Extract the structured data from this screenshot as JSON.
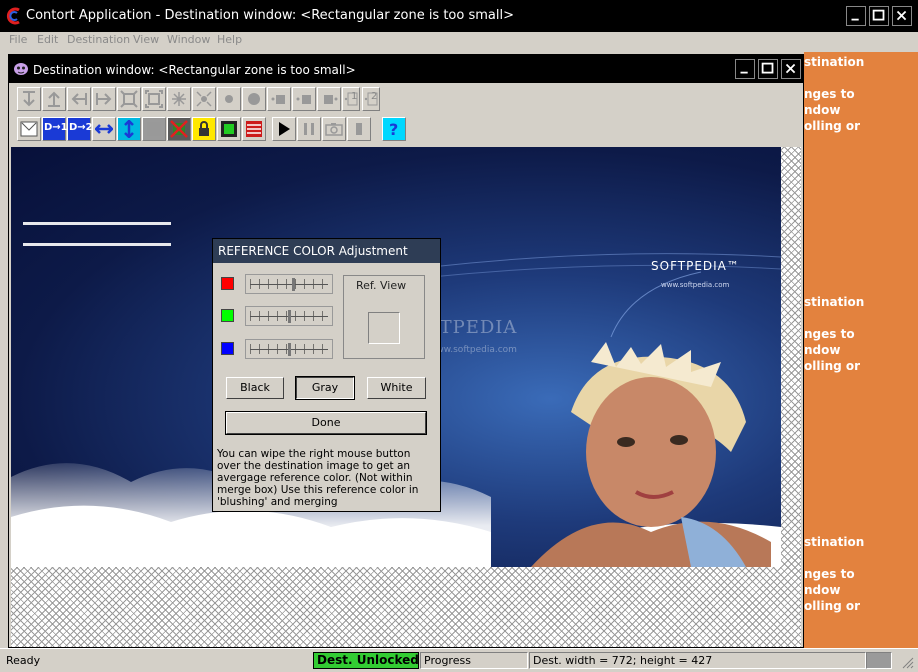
{
  "app": {
    "title": "Contort Application - Destination window: <Rectangular zone is too small>",
    "menu": [
      "File",
      "Edit",
      "Destination",
      "View",
      "Window",
      "Help"
    ]
  },
  "background_window_text": {
    "block1": [
      "stination",
      "",
      "nges to",
      "ndow",
      "olling or"
    ],
    "block2": [
      "stination",
      "",
      "nges to",
      "ndow",
      "olling or"
    ],
    "block3": [
      "stination",
      "",
      "nges to",
      "ndow",
      "olling or"
    ]
  },
  "child_window": {
    "title": "Destination window: <Rectangular zone is too small>",
    "toolbar_row1_icons": [
      "flip-down-icon",
      "flip-up-icon",
      "arrow-left-icon",
      "arrow-right-icon",
      "shrink-icon",
      "expand-icon",
      "zoom-in-icon",
      "zoom-out-icon",
      "dot-small-icon",
      "dot-large-icon",
      "point-left-icon",
      "point-center-icon",
      "point-right-icon",
      "marker-1-icon",
      "marker-2-icon"
    ],
    "toolbar_row1_labels": [
      "1",
      "2"
    ],
    "toolbar_row2_icons": [
      "merge-icon",
      "dest-1-icon",
      "dest-2-icon",
      "horizontal-stretch-icon",
      "vertical-stretch-icon",
      "blank-icon",
      "no-selection-icon",
      "lock-icon",
      "frame-icon",
      "flag-icon",
      "play-icon",
      "pause-icon",
      "camera-icon",
      "stop-icon",
      "help-icon"
    ],
    "toolbar_row2_labels": [
      "D→1",
      "D→2",
      "?"
    ],
    "watermark": "SOFTPEDIA",
    "watermark_url": "www.softpedia.com",
    "image_logo": "SOFTPEDIA™",
    "image_url": "www.softpedia.com"
  },
  "reference_dialog": {
    "title": "REFERENCE COLOR Adjustment",
    "swatch_colors": [
      "#ff0000",
      "#00ff00",
      "#0000ff"
    ],
    "slider_values": [
      0.55,
      0.5,
      0.5
    ],
    "ref_view_label": "Ref. View",
    "buttons": {
      "black": "Black",
      "gray": "Gray",
      "white": "White",
      "done": "Done"
    },
    "help_text": "You can wipe the right mouse button over the destination image to get an avergage reference color. (Not within merge box) Use this reference color in 'blushing' and merging"
  },
  "statusbar": {
    "ready": "Ready",
    "lock_status": "Dest. Unlocked",
    "progress": "Progress",
    "dimensions": "Dest. width = 772; height = 427"
  },
  "colors": {
    "background_window": "#e3823e",
    "lock_badge": "#33cc33",
    "titlebar": "#000000"
  }
}
